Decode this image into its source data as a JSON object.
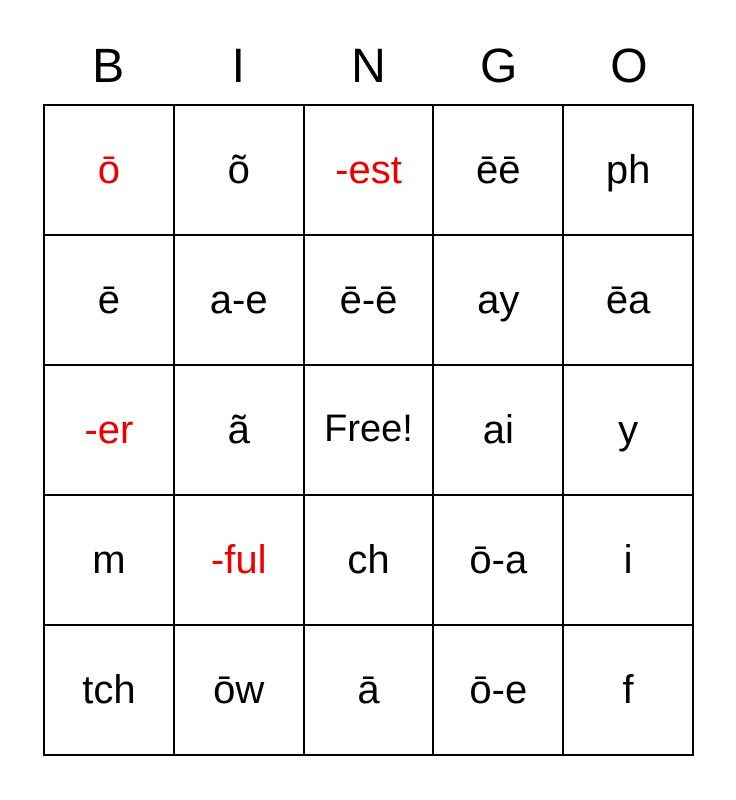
{
  "card": {
    "title": "BINGO",
    "free_space_label": "Free!",
    "marked_color": "#ee0000",
    "unmarked_color": "#000000",
    "background_color": "#ffffff",
    "border_color": "#000000",
    "columns": 5,
    "rows": 5,
    "headers": [
      "B",
      "I",
      "N",
      "G",
      "O"
    ],
    "cells": [
      [
        {
          "text": "ō",
          "marked": false
        },
        {
          "text": "õ",
          "marked": false
        },
        {
          "text": "-est",
          "marked": true
        },
        {
          "text": "ēē",
          "marked": false
        },
        {
          "text": "ph",
          "marked": false
        }
      ],
      [
        {
          "text": "ē",
          "marked": false
        },
        {
          "text": "a-e",
          "marked": false
        },
        {
          "text": "ē-ē",
          "marked": false
        },
        {
          "text": "ay",
          "marked": false
        },
        {
          "text": "ēa",
          "marked": false
        }
      ],
      [
        {
          "text": "-er",
          "marked": true
        },
        {
          "text": "ã",
          "marked": false
        },
        {
          "text": "Free!",
          "marked": false,
          "free": true
        },
        {
          "text": "ai",
          "marked": false
        },
        {
          "text": "y",
          "marked": false
        }
      ],
      [
        {
          "text": "m",
          "marked": false
        },
        {
          "text": "-ful",
          "marked": true
        },
        {
          "text": "ch",
          "marked": false
        },
        {
          "text": "ō-a",
          "marked": false
        },
        {
          "text": "i",
          "marked": false
        }
      ],
      [
        {
          "text": "tch",
          "marked": false
        },
        {
          "text": "ōw",
          "marked": false
        },
        {
          "text": "ā",
          "marked": false
        },
        {
          "text": "ō-e",
          "marked": false
        },
        {
          "text": "f",
          "marked": false
        }
      ]
    ]
  }
}
